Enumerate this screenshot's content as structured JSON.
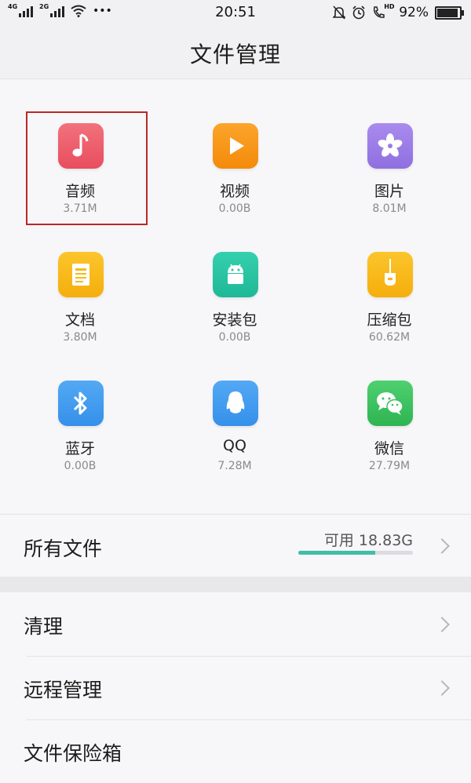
{
  "status_bar": {
    "net1": "4G",
    "net2": "2G",
    "dots": "•••",
    "time": "20:51",
    "hd": "HD",
    "battery": "92%"
  },
  "header": {
    "title": "文件管理"
  },
  "categories": [
    {
      "label": "音频",
      "size": "3.71M",
      "icon": "music-note-icon",
      "color": "#ee5b6a"
    },
    {
      "label": "视频",
      "size": "0.00B",
      "icon": "play-icon",
      "color": "#f7970f"
    },
    {
      "label": "图片",
      "size": "8.01M",
      "icon": "flower-icon",
      "color": "#9b7ce6"
    },
    {
      "label": "文档",
      "size": "3.80M",
      "icon": "document-icon",
      "color": "#f7b916"
    },
    {
      "label": "安装包",
      "size": "0.00B",
      "icon": "android-icon",
      "color": "#26c4a3"
    },
    {
      "label": "压缩包",
      "size": "60.62M",
      "icon": "zip-icon",
      "color": "#f7b916"
    },
    {
      "label": "蓝牙",
      "size": "0.00B",
      "icon": "bluetooth-icon",
      "color": "#3f9bf0"
    },
    {
      "label": "QQ",
      "size": "7.28M",
      "icon": "penguin-icon",
      "color": "#3f9bf0"
    },
    {
      "label": "微信",
      "size": "27.79M",
      "icon": "wechat-icon",
      "color": "#39c15a"
    }
  ],
  "all_files": {
    "label": "所有文件",
    "available": "可用 18.83G",
    "used_fraction": 0.67
  },
  "list": [
    {
      "label": "清理"
    },
    {
      "label": "远程管理"
    },
    {
      "label": "文件保险箱"
    }
  ]
}
